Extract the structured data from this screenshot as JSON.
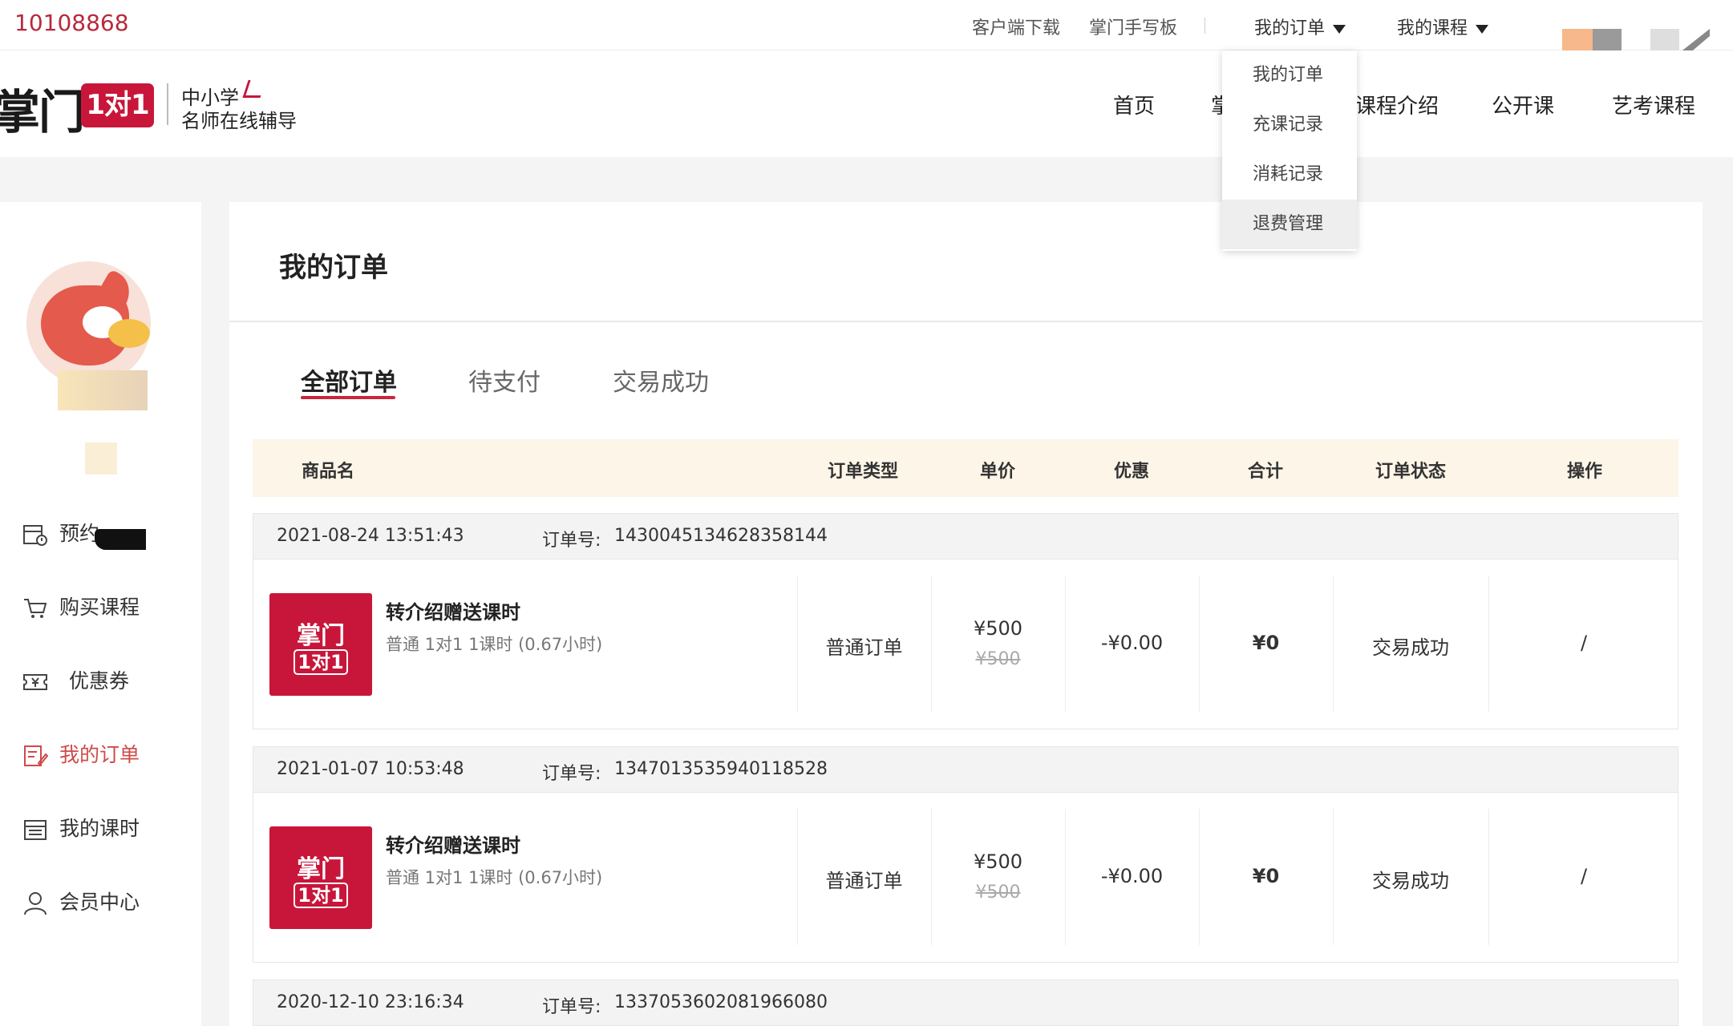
{
  "topbar": {
    "user_id": "10108868",
    "links": [
      "客户端下载",
      "掌门手写板"
    ],
    "menu_orders": "我的订单",
    "menu_courses": "我的课程"
  },
  "logo": {
    "text": "掌门",
    "badge": "1对1",
    "sub_line1": "中小学",
    "sub_line2": "名师在线辅导"
  },
  "nav": {
    "items": [
      "首页",
      "掌",
      "课程介绍",
      "公开课",
      "艺考课程"
    ]
  },
  "dropdown": {
    "items": [
      "我的订单",
      "充课记录",
      "消耗记录",
      "退费管理"
    ]
  },
  "sidebar": {
    "items": [
      {
        "label": "预约",
        "icon": "calendar-clock-icon"
      },
      {
        "label": "购买课程",
        "icon": "cart-icon"
      },
      {
        "label": "优惠券",
        "icon": "coupon-icon"
      },
      {
        "label": "我的订单",
        "icon": "order-edit-icon"
      },
      {
        "label": "我的课时",
        "icon": "schedule-icon"
      },
      {
        "label": "会员中心",
        "icon": "user-icon"
      }
    ],
    "active_index": 3
  },
  "main": {
    "title": "我的订单",
    "tabs": [
      "全部订单",
      "待支付",
      "交易成功"
    ],
    "columns": [
      "商品名",
      "订单类型",
      "单价",
      "优惠",
      "合计",
      "订单状态",
      "操作"
    ]
  },
  "orders": [
    {
      "time": "2021-08-24 13:51:43",
      "order_no_label": "订单号:",
      "order_no": "1430045134628358144",
      "thumb_top": "掌门",
      "thumb_bottom": "1对1",
      "product": "转介绍赠送课时",
      "desc": "普通 1对1 1课时 (0.67小时)",
      "type": "普通订单",
      "price": "¥500",
      "price_orig": "¥500",
      "discount": "-¥0.00",
      "total": "¥0",
      "status": "交易成功",
      "action": "/"
    },
    {
      "time": "2021-01-07 10:53:48",
      "order_no_label": "订单号:",
      "order_no": "1347013535940118528",
      "thumb_top": "掌门",
      "thumb_bottom": "1对1",
      "product": "转介绍赠送课时",
      "desc": "普通 1对1 1课时 (0.67小时)",
      "type": "普通订单",
      "price": "¥500",
      "price_orig": "¥500",
      "discount": "-¥0.00",
      "total": "¥0",
      "status": "交易成功",
      "action": "/"
    },
    {
      "time": "2020-12-10 23:16:34",
      "order_no_label": "订单号:",
      "order_no": "1337053602081966080"
    }
  ],
  "colors": {
    "brand_red": "#c8163a",
    "header_bg": "#fdf5e8",
    "active_side": "#d04a4a"
  }
}
